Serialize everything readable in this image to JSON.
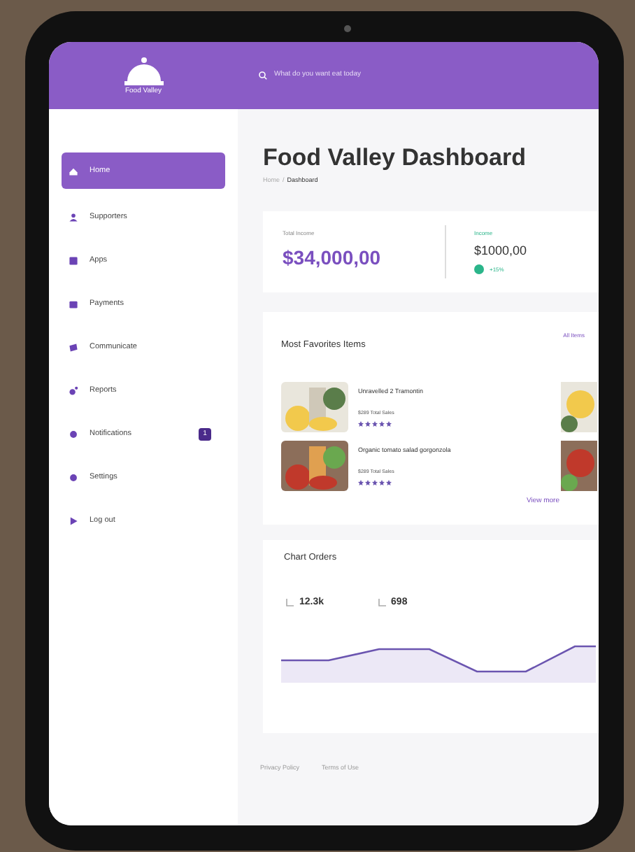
{
  "header": {
    "logo_text": "Food Valley",
    "search": {
      "placeholder": "What do you want eat today"
    }
  },
  "sidebar": {
    "items": [
      {
        "label": "Home",
        "selected": true
      },
      {
        "label": "Supporters",
        "selected": false
      },
      {
        "label": "Apps",
        "selected": false
      },
      {
        "label": "Payments",
        "selected": false
      },
      {
        "label": "Communicate",
        "selected": false
      },
      {
        "label": "Reports",
        "selected": false
      },
      {
        "label": "Notifications",
        "selected": false,
        "badge": "1"
      },
      {
        "label": "Settings",
        "selected": false
      },
      {
        "label": "Log out",
        "selected": false
      }
    ]
  },
  "page": {
    "title": "Food Valley Dashboard",
    "breadcrumb": [
      "Home",
      "Dashboard"
    ],
    "breadcrumb_separator": "/"
  },
  "income": {
    "total_label": "Total Income",
    "total": "$34,000,00",
    "label": "Income",
    "amount": "$1000,00",
    "change": "+15%"
  },
  "favorites": {
    "title": "Most Favorites Items",
    "link": "All Items",
    "items": [
      {
        "name": "Unravelled 2 Tramontin",
        "sales": "$289 Total Sales",
        "stars": 5
      },
      {
        "name": "Organic tomato salad gorgonzola",
        "sales": "$289 Total Sales",
        "stars": 5
      }
    ],
    "more": "View more"
  },
  "orders": {
    "title": "Chart Orders",
    "stats": [
      "12.3k",
      "698"
    ]
  },
  "footer": [
    "Privacy Policy",
    "Terms of Use"
  ]
}
